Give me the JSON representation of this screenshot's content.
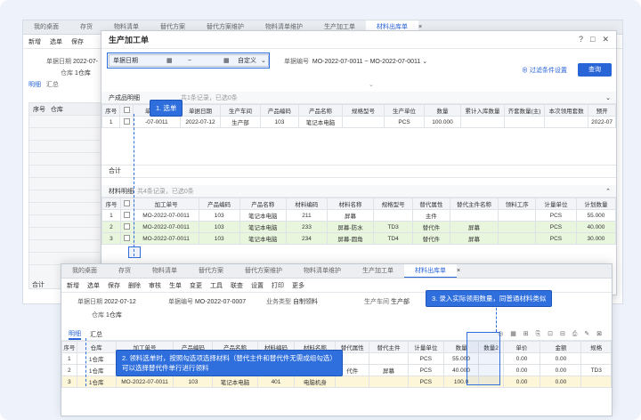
{
  "bg_window": {
    "tabs": [
      "我的桌面",
      "存货",
      "物料清单",
      "替代方案",
      "替代方案维护",
      "物料清单维护",
      "生产加工单",
      "材料出库单"
    ],
    "active_tab": "材料出库单",
    "toolbar": [
      "新增",
      "选单",
      "保存"
    ],
    "form": {
      "date_label": "单据日期",
      "date_value": "2022-07-",
      "warehouse_label": "仓库",
      "warehouse_value": "1仓库"
    },
    "subtabs": [
      "明细",
      "汇总"
    ],
    "grid_header": [
      "序号",
      "仓库"
    ],
    "footer": "合计"
  },
  "dialog": {
    "title": "生产加工单",
    "filter": {
      "date_label": "单据日期",
      "date_tilde": "~",
      "custom": "自定义",
      "code_label": "单据编号",
      "code_from": "MO-2022-07-0011",
      "code_tilde": "~",
      "code_to": "MO-2022-07-0011",
      "settings": "过滤条件设置",
      "query": "查询"
    },
    "product_section": {
      "title": "产成品明细",
      "sub": "共1条记录，已选0条"
    },
    "product_headers": [
      "序号",
      "",
      "单据编号",
      "单据日期",
      "生产车间",
      "产品编码",
      "产品名称",
      "规格型号",
      "生产单位",
      "数量",
      "累计入库数量",
      "齐套数量(主)",
      "本次领用套数",
      "预开"
    ],
    "product_rows": [
      [
        "1",
        "",
        "-07-0011",
        "2022-07-12",
        "生产部",
        "103",
        "笔记本电脑",
        "",
        "PCS",
        "100.000",
        "",
        "",
        "",
        "2022-07"
      ]
    ],
    "sum": "合计",
    "material_section": {
      "title": "材料明细",
      "sub": "共4条记录，已选0条"
    },
    "material_headers": [
      "序号",
      "",
      "加工单号",
      "产品编码",
      "产品名称",
      "材料编码",
      "材料名称",
      "规格型号",
      "替代属性",
      "替代主件名称",
      "领料工序",
      "计量单位",
      "计划数量"
    ],
    "material_rows": [
      [
        "1",
        "",
        "MO-2022-07-0011",
        "103",
        "笔记本电脑",
        "211",
        "屏幕",
        "",
        "主件",
        "",
        "",
        "PCS",
        "55.000"
      ],
      [
        "2",
        "",
        "MO-2022-07-0011",
        "103",
        "笔记本电脑",
        "233",
        "屏幕-防水",
        "TD3",
        "替代件",
        "屏幕",
        "",
        "PCS",
        "40.000"
      ],
      [
        "3",
        "",
        "MO-2022-07-0011",
        "103",
        "笔记本电脑",
        "234",
        "屏幕-圆角",
        "TD4",
        "替代件",
        "屏幕",
        "",
        "PCS",
        "30.000"
      ]
    ]
  },
  "fg_window": {
    "tabs": [
      "我的桌面",
      "存货",
      "物料清单",
      "替代方案",
      "替代方案维护",
      "物料清单维护",
      "生产加工单",
      "材料出库单"
    ],
    "active_tab": "材料出库单",
    "toolbar": [
      "新增",
      "选单",
      "保存",
      "删除",
      "审核",
      "生单",
      "变更",
      "工具",
      "联查",
      "设置",
      "打印",
      "更多"
    ],
    "form": {
      "date_label": "单据日期",
      "date_value": "2022-07-12",
      "code_label": "单据编号",
      "code_value": "MO-2022-07-0007",
      "biz_label": "业务类型",
      "biz_value": "自制领料",
      "dept_label": "生产车间",
      "dept_value": "生产部",
      "wh_label": "仓库",
      "wh_value": "1仓库"
    },
    "subtabs": [
      "明细",
      "汇总"
    ],
    "headers": [
      "序号",
      "仓库",
      "加工单号",
      "产品编码",
      "产品名称",
      "材料编码",
      "材料名称",
      "替代属性",
      "替代主件",
      "计量单位",
      "数量",
      "数量2",
      "单价",
      "金额",
      "规格"
    ],
    "rows": [
      [
        "1",
        "1仓库",
        "",
        "",
        "",
        "",
        "",
        "",
        "",
        "PCS",
        "55.000",
        "",
        "0.00",
        "0.00",
        ""
      ],
      [
        "2",
        "1仓库",
        "",
        "",
        "",
        "",
        "",
        "代件",
        "屏幕",
        "PCS",
        "40.000",
        "",
        "0.00",
        "0.00",
        "TD3"
      ],
      [
        "3",
        "1仓库",
        "MO-2022-07-0011",
        "103",
        "笔记本电脑",
        "401",
        "电脑机身",
        "",
        "",
        "PCS",
        "100.0",
        "",
        "0.00",
        "0.00",
        ""
      ]
    ]
  },
  "annotations": {
    "a1": "1. 选单",
    "a2_line1": "2. 领料选单时，按照勾选项选择材料（替代主件和替代件无需成组勾选）",
    "a2_line2": "可以选择替代件单行进行领料",
    "a3": "3. 录入实际领用数量，同普通材料类似"
  },
  "colors": {
    "accent": "#2a65d8",
    "row_green": "#e9f6de"
  }
}
